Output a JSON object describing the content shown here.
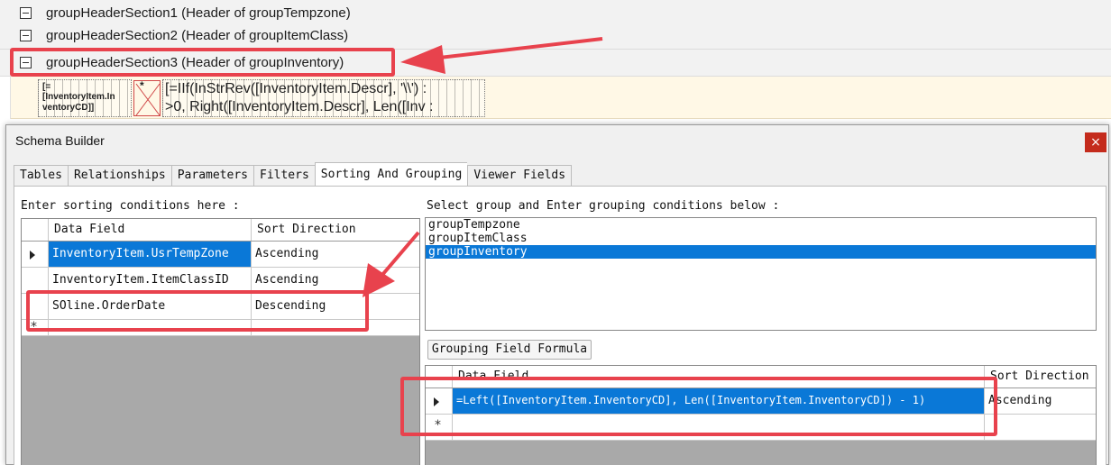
{
  "designer": {
    "sections": [
      {
        "label": "groupHeaderSection1 (Header of groupTempzone)"
      },
      {
        "label": "groupHeaderSection2 (Header of groupItemClass)"
      },
      {
        "label": "groupHeaderSection3 (Header of groupInventory)"
      }
    ],
    "detail": {
      "field1_lines": [
        "[=",
        "[InventoryItem.In",
        "ventoryCD]]"
      ],
      "field2_mark": "*",
      "formula_lines": [
        "[=IIf(InStrRev([InventoryItem.Descr], '\\\\') :",
        ">0, Right([InventoryItem.Descr], Len([Inv :"
      ]
    }
  },
  "window": {
    "title": "Schema Builder",
    "close_glyph": "×",
    "tabs": [
      "Tables",
      "Relationships",
      "Parameters",
      "Filters",
      "Sorting And Grouping",
      "Viewer Fields"
    ],
    "active_tab": "Sorting And Grouping",
    "sorting": {
      "prompt": "Enter sorting conditions here :",
      "headers": [
        "Data Field",
        "Sort Direction"
      ],
      "rows": [
        {
          "field": "InventoryItem.UsrTempZone",
          "direction": "Ascending"
        },
        {
          "field": "InventoryItem.ItemClassID",
          "direction": "Ascending"
        },
        {
          "field": "SOline.OrderDate",
          "direction": "Descending"
        }
      ],
      "new_row_marker": "*"
    },
    "grouping": {
      "prompt": "Select group and Enter grouping conditions below :",
      "groups": [
        "groupTempzone",
        "groupItemClass",
        "groupInventory"
      ],
      "selected_group": "groupInventory",
      "formula_button": "Grouping Field Formula",
      "headers": [
        "Data Field",
        "Sort Direction"
      ],
      "rows": [
        {
          "field": "=Left([InventoryItem.InventoryCD], Len([InventoryItem.InventoryCD]) - 1)",
          "direction": "Ascending"
        }
      ],
      "new_row_marker": "*"
    }
  },
  "colors": {
    "highlight": "#e8424d",
    "selection": "#0a78d7",
    "detail_band": "#fff8e6"
  }
}
